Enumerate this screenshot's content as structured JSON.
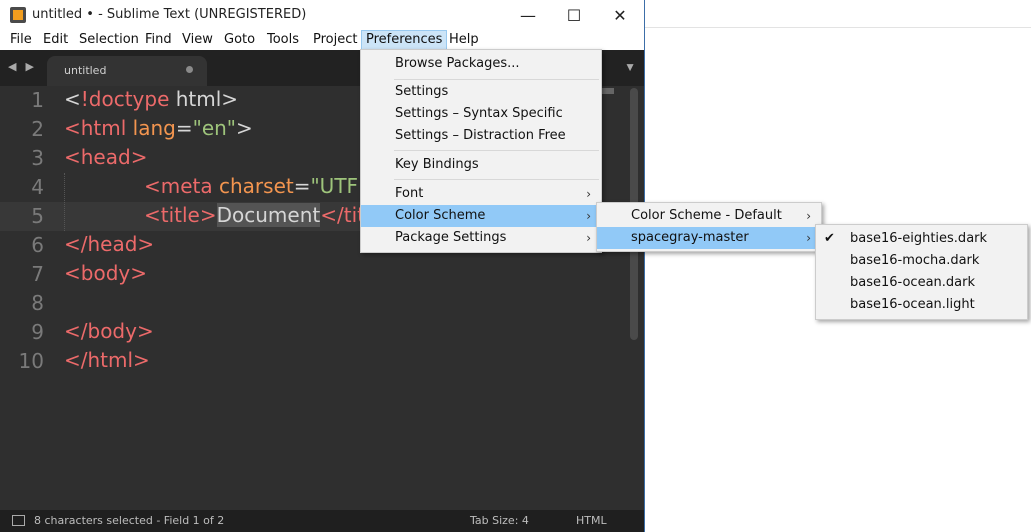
{
  "window": {
    "title": "untitled • - Sublime Text (UNREGISTERED)",
    "minimize": "—",
    "maximize": "☐",
    "close": "✕"
  },
  "menubar": [
    "File",
    "Edit",
    "Selection",
    "Find",
    "View",
    "Goto",
    "Tools",
    "Project",
    "Preferences",
    "Help"
  ],
  "tabs": {
    "nav": "◀ ▶",
    "active_tab": "untitled",
    "dropdown": "▼"
  },
  "editor": {
    "line_numbers": [
      "1",
      "2",
      "3",
      "4",
      "5",
      "6",
      "7",
      "8",
      "9",
      "10"
    ],
    "code": {
      "l1_open": "<",
      "l1_tag": "!doctype",
      "l1_rest": " html>",
      "l2_open": "<html ",
      "l2_attr": "lang",
      "l2_eq": "=",
      "l2_str": "\"en\"",
      "l2_close": ">",
      "l3": "<head>",
      "l4_open": "<meta ",
      "l4_attr": "charset",
      "l4_eq": "=",
      "l4_str": "\"UTF",
      "l5_open": "<title>",
      "l5_sel": "Document",
      "l5_close": "</tit",
      "l6": "</head>",
      "l7": "<body>",
      "l9": "</body>",
      "l10": "</html>"
    }
  },
  "status": {
    "selection": "8 characters selected - Field 1 of 2",
    "tab_size": "Tab Size: 4",
    "syntax": "HTML"
  },
  "preferences_menu": {
    "browse_packages": "Browse Packages...",
    "settings": "Settings",
    "settings_syntax": "Settings – Syntax Specific",
    "settings_distraction": "Settings – Distraction Free",
    "key_bindings": "Key Bindings",
    "font": "Font",
    "color_scheme": "Color Scheme",
    "package_settings": "Package Settings"
  },
  "color_scheme_menu": {
    "default": "Color Scheme - Default",
    "spacegray": "spacegray-master"
  },
  "spacegray_menu": {
    "items": [
      "base16-eighties.dark",
      "base16-mocha.dark",
      "base16-ocean.dark",
      "base16-ocean.light"
    ],
    "checked": "base16-eighties.dark",
    "check_mark": "✔"
  },
  "arrow": "›"
}
